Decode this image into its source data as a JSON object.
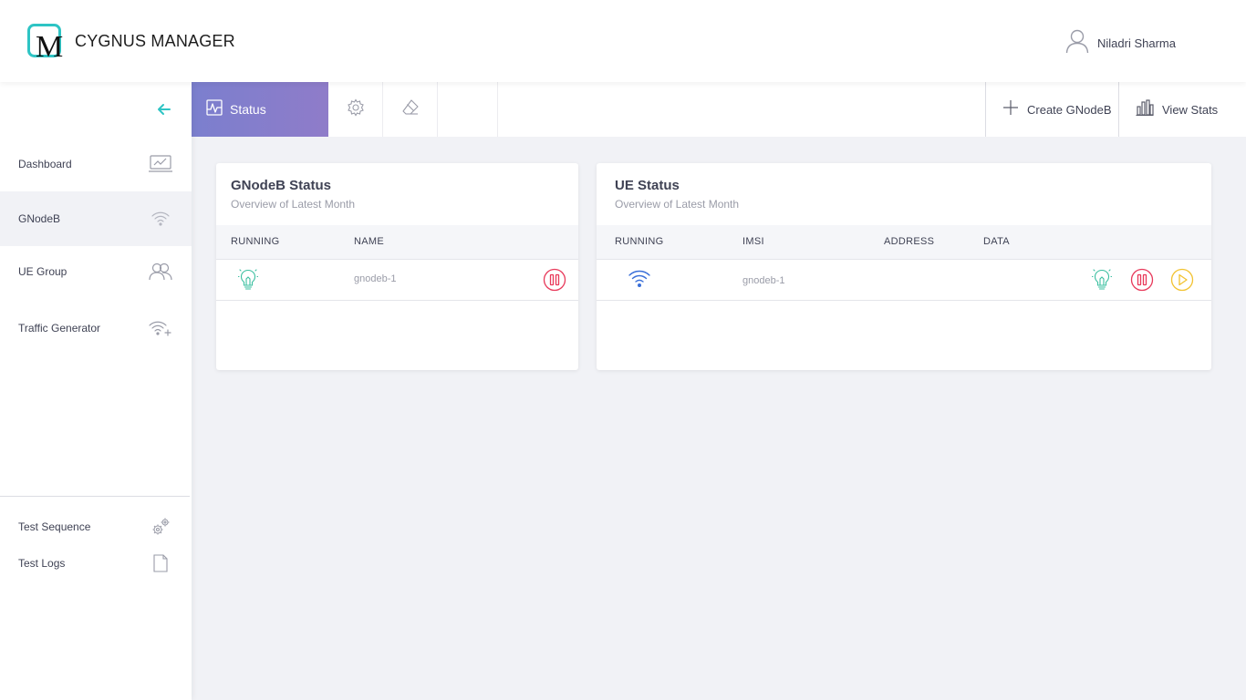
{
  "header": {
    "logo_letter": "M",
    "app_name_a": "CYGNUS",
    "app_name_b": " MANAGER",
    "user_name": "Niladri Sharma",
    "brand_color": "#2ec4c4"
  },
  "sidebar": {
    "items": [
      {
        "label": "Dashboard",
        "icon": "laptop-icon"
      },
      {
        "label": "GNodeB",
        "icon": "wifi-icon"
      },
      {
        "label": "UE Group",
        "icon": "users-icon"
      },
      {
        "label": "Traffic Generator",
        "icon": "wifi-plus-icon"
      }
    ],
    "bottom_items": [
      {
        "label": "Test Sequence",
        "icon": "gears-icon"
      },
      {
        "label": "Test Logs",
        "icon": "document-icon"
      }
    ]
  },
  "toolbar": {
    "status_label": "Status",
    "create_label": "Create GNodeB",
    "stats_label": "View Stats",
    "accent_gradient": [
      "#7b7fce",
      "#8f7cc9"
    ]
  },
  "gnodeb_card": {
    "title": "GNodeB Status",
    "subtitle": "Overview of Latest Month",
    "columns": [
      "RUNNING",
      "NAME"
    ],
    "rows": [
      {
        "name": "gnodeb-1"
      }
    ]
  },
  "ue_card": {
    "title": "UE Status",
    "subtitle": "Overview of Latest Month",
    "columns": [
      "RUNNING",
      "IMSI",
      "ADDRESS",
      "DATA"
    ],
    "rows": [
      {
        "imsi": "gnodeb-1"
      }
    ]
  },
  "colors": {
    "running_green": "#3bbfa0",
    "stop_red": "#e8395a",
    "play_yellow": "#f2c230",
    "wifi_blue": "#3a6fd8"
  }
}
